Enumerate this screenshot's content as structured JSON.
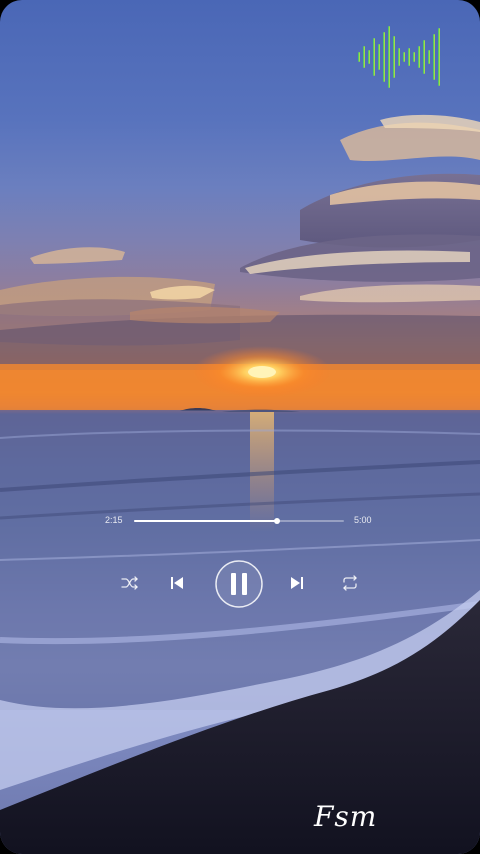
{
  "player": {
    "elapsed": "2:15",
    "duration": "5:00",
    "progress": 0.68,
    "state": "playing"
  },
  "icons": {
    "visualizer": "audio-visualizer-icon",
    "shuffle": "shuffle-icon",
    "previous": "skip-previous-icon",
    "play_pause": "pause-icon",
    "next": "skip-next-icon",
    "repeat": "repeat-icon"
  },
  "watermark": {
    "text": "Fsm"
  },
  "colors": {
    "visualizer_start": "#2fbf7a",
    "visualizer_end": "#d8e63a",
    "sun": "#ffe27a",
    "sand": "#1a1a2a"
  }
}
